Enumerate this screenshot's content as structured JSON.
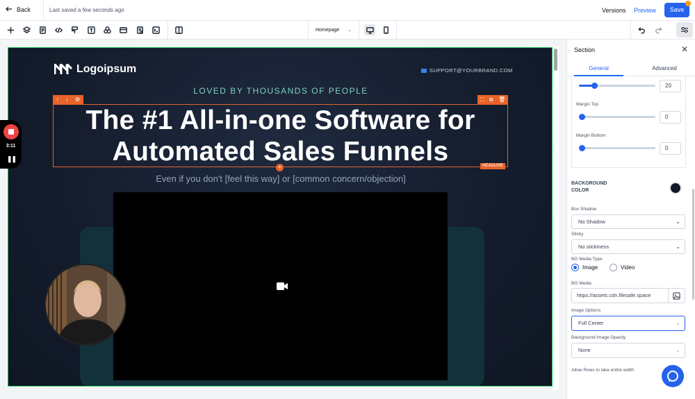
{
  "topbar": {
    "back_label": "Back",
    "saved_status": "Last saved a few seconds ago",
    "versions_label": "Versions",
    "preview_label": "Preview",
    "save_label": "Save"
  },
  "toolbar": {
    "left_icons": [
      "add-icon",
      "layers-icon",
      "pages-icon",
      "code-icon",
      "paint-icon",
      "text-icon",
      "blocks-icon",
      "layout-icon",
      "form-icon",
      "terminal-icon",
      "columns-icon"
    ],
    "page_select": "Homepage",
    "device_icons": [
      "desktop-icon",
      "mobile-icon"
    ],
    "right_icons": [
      "undo-icon",
      "redo-icon",
      "settings-sliders-icon"
    ]
  },
  "canvas": {
    "logo_text": "Logoipsum",
    "support_email": "SUPPORT@YOURBRAND.COM",
    "loved_text": "LOVED BY THOUSANDS OF PEOPLE",
    "headline_line1": "The #1 All-in-one Software for",
    "headline_line2": "Automated Sales Funnels",
    "headline_tag": "HEADLINE",
    "subline": "Even if you don't [feel this way] or [common concern/objection]"
  },
  "recorder": {
    "time": "3:11"
  },
  "panel": {
    "title": "Section",
    "tabs": [
      "General",
      "Advanced"
    ],
    "active_tab": "General",
    "spacing": {
      "value_top": "20",
      "margin_top_label": "Margin Top",
      "margin_top_value": "0",
      "margin_bottom_label": "Margin Bottom",
      "margin_bottom_value": "0"
    },
    "bg_color_label_1": "BACKGROUND",
    "bg_color_label_2": "COLOR",
    "bg_color": "#111827",
    "box_shadow_label": "Box Shadow",
    "box_shadow_value": "No Shadow",
    "sticky_label": "Sticky",
    "sticky_value": "No stickiness",
    "bg_media_type_label": "BG Media Type",
    "media_types": [
      "Image",
      "Video"
    ],
    "media_type_selected": "Image",
    "bg_media_label": "BG Media",
    "bg_media_value": "https://assets.cdn.filesafe.space",
    "image_options_label": "Image Options",
    "image_options_value": "Full Center",
    "bg_opacity_label": "Background Image Opacity",
    "bg_opacity_value": "None",
    "allow_rows_label": "Allow Rows to take entire width"
  },
  "colors": {
    "accent": "#2563eb",
    "selection": "#e8632a",
    "section_border": "#22c55e"
  }
}
